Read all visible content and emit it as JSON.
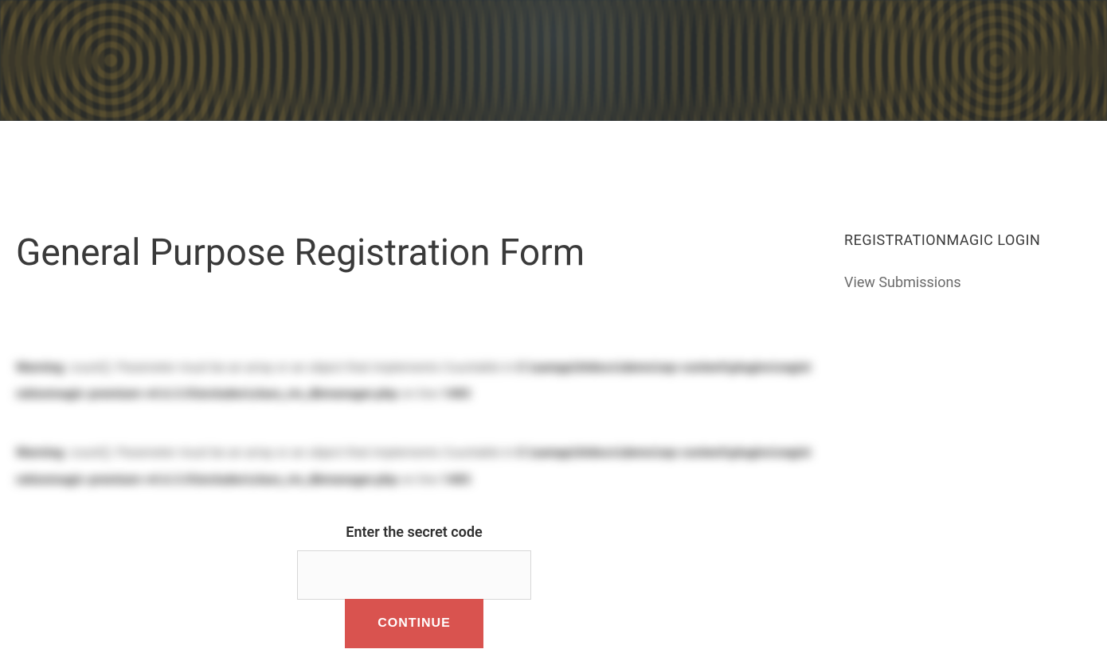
{
  "hero": {},
  "main": {
    "title": "General Purpose Registration Form",
    "warnings": [
      {
        "prefix": "Warning",
        "message": ": count(): Parameter must be an array or an object that implements Countable in ",
        "path": "C:\\xampp\\htdocs\\demo\\wp-content\\plugins\\registrationmagic-premium-v4.6.3.0\\includes\\class_rm_dbmanager.php",
        "suffix": " on line ",
        "line": "1483"
      },
      {
        "prefix": "Warning",
        "message": ": count(): Parameter must be an array or an object that implements Countable in ",
        "path": "C:\\xampp\\htdocs\\demo\\wp-content\\plugins\\registrationmagic-premium-v4.6.3.0\\includes\\class_rm_dbmanager.php",
        "suffix": " on line ",
        "line": "1483"
      }
    ],
    "form": {
      "label": "Enter the secret code",
      "value": "",
      "button": "CONTINUE"
    }
  },
  "sidebar": {
    "title": "REGISTRATIONMAGIC LOGIN",
    "links": [
      {
        "label": "View Submissions"
      }
    ]
  }
}
